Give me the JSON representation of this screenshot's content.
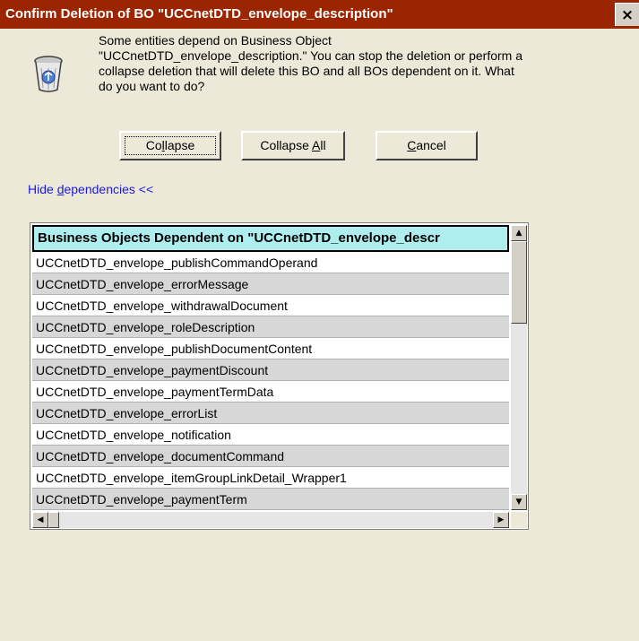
{
  "window": {
    "title": "Confirm Deletion of BO \"UCCnetDTD_envelope_description\"",
    "close_label": "×"
  },
  "message": {
    "text": "Some entities depend on Business Object \"UCCnetDTD_envelope_description.\" You can stop the deletion or perform a collapse deletion that will delete this BO and all BOs dependent on it. What do you want to do?"
  },
  "buttons": {
    "collapse": {
      "pre": "Co",
      "mnemonic": "l",
      "post": "lapse"
    },
    "collapse_all": {
      "pre": "Collapse ",
      "mnemonic": "A",
      "post": "ll"
    },
    "cancel": {
      "pre": "",
      "mnemonic": "C",
      "post": "ancel"
    }
  },
  "dependencies_link": {
    "pre": "Hide ",
    "mnemonic": "d",
    "post": "ependencies <<"
  },
  "table": {
    "header": "Business Objects Dependent on \"UCCnetDTD_envelope_descr",
    "rows": [
      "UCCnetDTD_envelope_publishCommandOperand",
      "UCCnetDTD_envelope_errorMessage",
      "UCCnetDTD_envelope_withdrawalDocument",
      "UCCnetDTD_envelope_roleDescription",
      "UCCnetDTD_envelope_publishDocumentContent",
      "UCCnetDTD_envelope_paymentDiscount",
      "UCCnetDTD_envelope_paymentTermData",
      "UCCnetDTD_envelope_errorList",
      "UCCnetDTD_envelope_notification",
      "UCCnetDTD_envelope_documentCommand",
      "UCCnetDTD_envelope_itemGroupLinkDetail_Wrapper1",
      "UCCnetDTD_envelope_paymentTerm"
    ]
  },
  "scrollbar_icons": {
    "up": "▲",
    "down": "▼",
    "left": "◀",
    "right": "▶"
  },
  "colors": {
    "titlebar": "#9b2500",
    "header_bg": "#aeeeee",
    "link": "#1a1ad6"
  }
}
